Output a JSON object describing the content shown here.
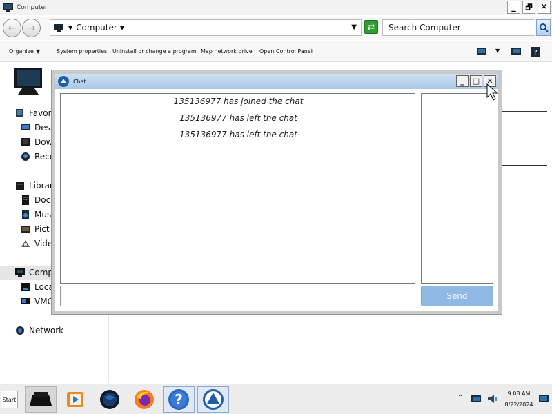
{
  "window": {
    "title": "Computer"
  },
  "address": {
    "crumb": "Computer",
    "search_placeholder": "Search Computer"
  },
  "commands": [
    "Organize",
    "System properties",
    "Uninstall or change a program",
    "Map network drive",
    "Open Control Panel"
  ],
  "nav": {
    "favorites": "Favori",
    "desktop": "Desk",
    "downloads": "Dow",
    "recent": "Rece",
    "libraries": "Librar",
    "documents": "Doc",
    "music": "Mus",
    "pictures": "Pict",
    "videos": "Vide",
    "computer": "Comp",
    "local_disk": "Loca",
    "vm": "VMC",
    "network": "Network"
  },
  "chat": {
    "title": "Chat",
    "messages": [
      "135136977 has joined the chat",
      "135136977 has left the chat",
      "135136977 has left the chat"
    ],
    "input_value": "",
    "send_label": "Send"
  },
  "taskbar": {
    "start_label": "Start",
    "time": "9:08 AM",
    "date": "8/22/2024"
  }
}
